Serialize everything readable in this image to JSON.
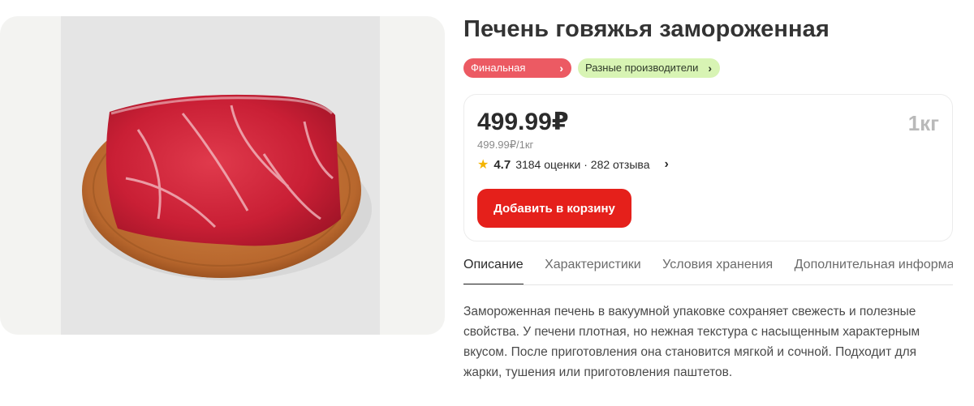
{
  "product": {
    "title": "Печень говяжья замороженная",
    "image_alt": "beef-liver-on-wooden-board"
  },
  "badges": [
    {
      "label": "Финальная цена",
      "color": "#ec5a63"
    },
    {
      "label": "Разные производители",
      "color": "#d8f4b4"
    }
  ],
  "price_card": {
    "price": "499.99₽",
    "unit_price": "499.99₽/1кг",
    "weight": "1кг",
    "rating_score": "4.7",
    "rating_text": "3184 оценки · 282 отзыва",
    "add_to_cart_label": "Добавить в корзину",
    "accent_color": "#e5201b"
  },
  "tabs": [
    {
      "label": "Описание",
      "active": true
    },
    {
      "label": "Характеристики",
      "active": false
    },
    {
      "label": "Условия хранения",
      "active": false
    },
    {
      "label": "Дополнительная информация",
      "active": false
    }
  ],
  "description": "Замороженная печень в вакуумной упаковке сохраняет свежесть и полезные свойства. У печени плотная, но нежная текстура с насыщенным характерным вкусом. После приготовления она становится мягкой и сочной. Подходит для жарки, тушения или приготовления паштетов."
}
